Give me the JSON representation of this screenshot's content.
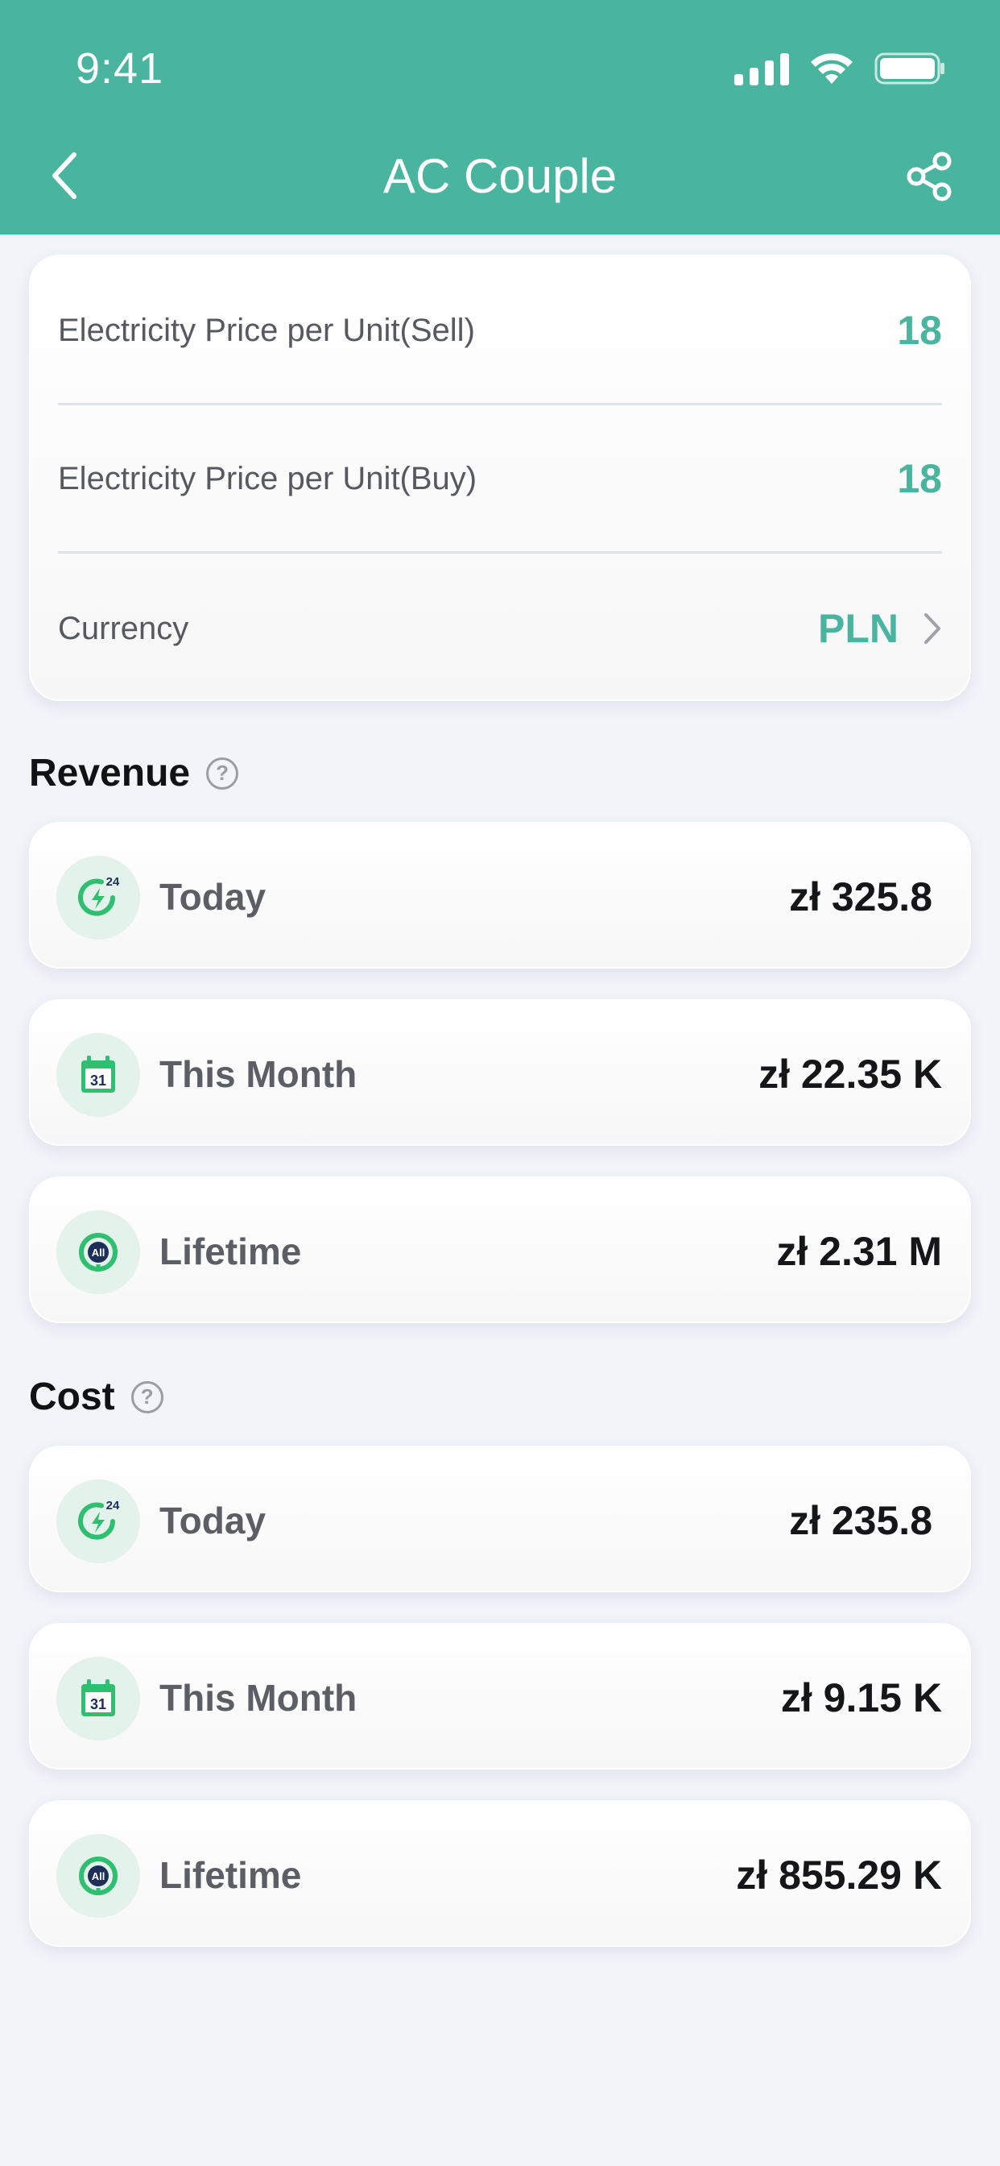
{
  "status_bar": {
    "time": "9:41"
  },
  "nav": {
    "title": "AC Couple"
  },
  "settings": {
    "sell_label": "Electricity Price per Unit(Sell)",
    "sell_value": "18",
    "buy_label": "Electricity Price per Unit(Buy)",
    "buy_value": "18",
    "currency_label": "Currency",
    "currency_value": "PLN"
  },
  "revenue": {
    "title": "Revenue",
    "items": [
      {
        "label": "Today",
        "value": "zł 325.8",
        "icon": "24h-energy-icon",
        "icon_text": "24"
      },
      {
        "label": "This Month",
        "value": "zł 22.35 K",
        "icon": "calendar-icon",
        "icon_text": "31"
      },
      {
        "label": "Lifetime",
        "value": "zł 2.31 M",
        "icon": "lifetime-all-icon",
        "icon_text": "All"
      }
    ]
  },
  "cost": {
    "title": "Cost",
    "items": [
      {
        "label": "Today",
        "value": "zł 235.8",
        "icon": "24h-energy-icon",
        "icon_text": "24"
      },
      {
        "label": "This Month",
        "value": "zł 9.15 K",
        "icon": "calendar-icon",
        "icon_text": "31"
      },
      {
        "label": "Lifetime",
        "value": "zł 855.29 K",
        "icon": "lifetime-all-icon",
        "icon_text": "All"
      }
    ]
  },
  "colors": {
    "brand": "#49b59f",
    "accent_text": "#4ab59f",
    "icon_green": "#2fbf71",
    "background": "#f1f4f9"
  }
}
